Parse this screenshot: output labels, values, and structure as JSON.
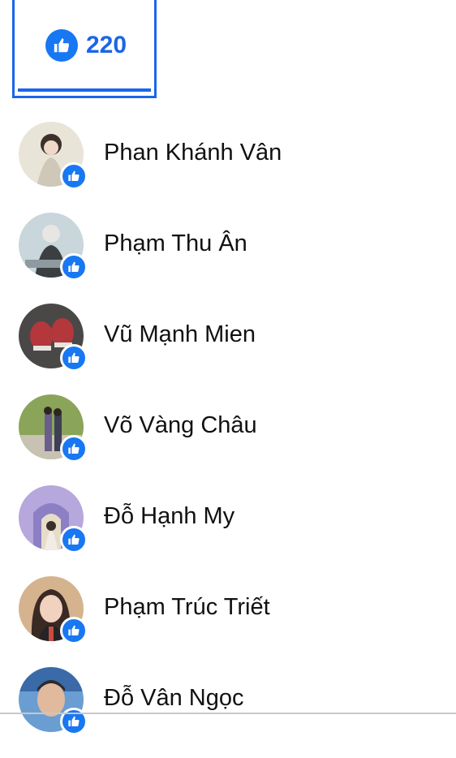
{
  "reactions_tab": {
    "count": "220",
    "icon": "thumbs-up-icon",
    "color": "#1a66e8"
  },
  "people": [
    {
      "name": "Phan Khánh Vân",
      "avatar_colors": [
        "#e9e4d8",
        "#cfc7b8",
        "#6f5e54"
      ]
    },
    {
      "name": "Phạm Thu Ân",
      "avatar_colors": [
        "#c9d6dc",
        "#3b3f42",
        "#8e9aa0"
      ]
    },
    {
      "name": "Vũ Mạnh Mien",
      "avatar_colors": [
        "#4a4847",
        "#b4373c",
        "#e7e4df"
      ]
    },
    {
      "name": "Võ Vàng Châu",
      "avatar_colors": [
        "#8aa45a",
        "#6a5e8c",
        "#c8c2b2"
      ]
    },
    {
      "name": "Đỗ Hạnh My",
      "avatar_colors": [
        "#b6a7dd",
        "#8c7fc4",
        "#e6ddc9"
      ]
    },
    {
      "name": "Phạm Trúc Triết",
      "avatar_colors": [
        "#d4b38e",
        "#3a2a24",
        "#c94c3f"
      ]
    },
    {
      "name": "Đỗ Vân Ngọc",
      "avatar_colors": [
        "#6a9ed3",
        "#e1ba9d",
        "#2b2b2b"
      ]
    }
  ]
}
